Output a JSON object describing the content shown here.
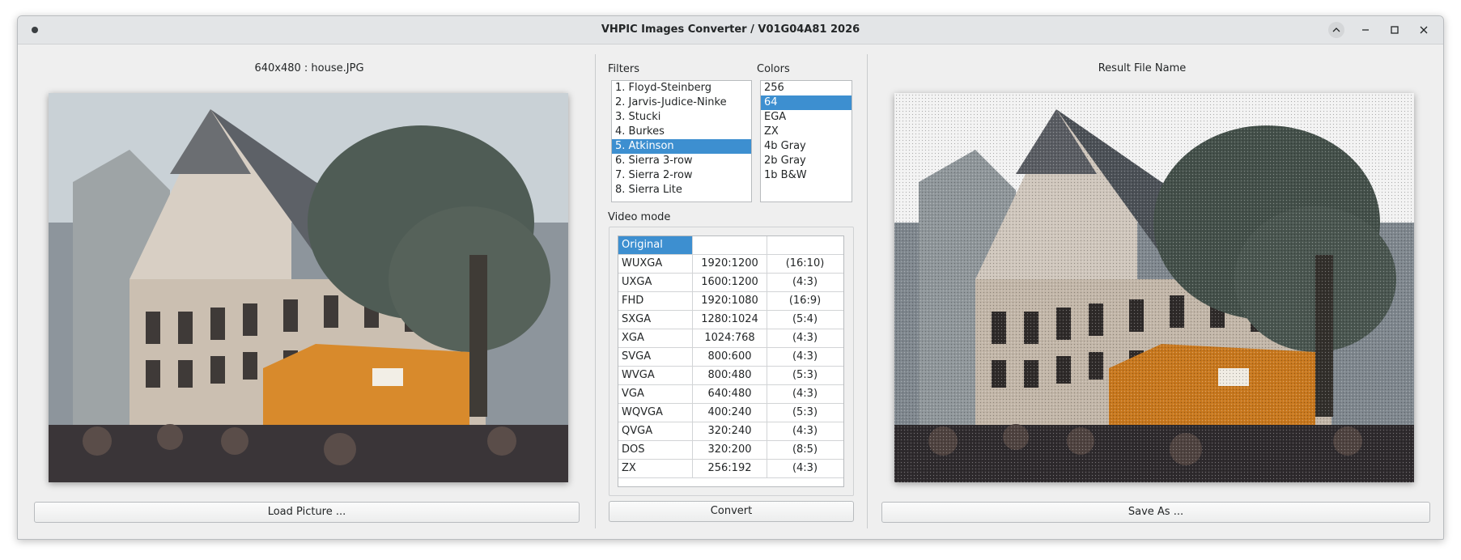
{
  "window": {
    "title": "VHPIC Images Converter / V01G04A81 2026"
  },
  "left_panel": {
    "label": "640x480 : house.JPG",
    "button": "Load Picture ..."
  },
  "filters": {
    "label": "Filters",
    "items": [
      "1. Floyd-Steinberg",
      "2. Jarvis-Judice-Ninke",
      "3. Stucki",
      "4. Burkes",
      "5. Atkinson",
      "6. Sierra 3-row",
      "7. Sierra 2-row",
      "8. Sierra Lite"
    ],
    "selected": 4
  },
  "colors": {
    "label": "Colors",
    "items": [
      "256",
      "64",
      "EGA",
      "ZX",
      "4b Gray",
      "2b Gray",
      "1b B&W"
    ],
    "selected": 1
  },
  "video_mode": {
    "label": "Video mode",
    "header": [
      "Original",
      "",
      ""
    ],
    "rows": [
      [
        "WUXGA",
        "1920:1200",
        "(16:10)"
      ],
      [
        "UXGA",
        "1600:1200",
        "(4:3)"
      ],
      [
        "FHD",
        "1920:1080",
        "(16:9)"
      ],
      [
        "SXGA",
        "1280:1024",
        "(5:4)"
      ],
      [
        "XGA",
        "1024:768",
        "(4:3)"
      ],
      [
        "SVGA",
        "800:600",
        "(4:3)"
      ],
      [
        "WVGA",
        "800:480",
        "(5:3)"
      ],
      [
        "VGA",
        "640:480",
        "(4:3)"
      ],
      [
        "WQVGA",
        "400:240",
        "(5:3)"
      ],
      [
        "QVGA",
        "320:240",
        "(4:3)"
      ],
      [
        "DOS",
        "320:200",
        "(8:5)"
      ],
      [
        "ZX",
        "256:192",
        "(4:3)"
      ]
    ]
  },
  "center": {
    "button": "Convert"
  },
  "right_panel": {
    "label": "Result File Name",
    "button": "Save As ..."
  },
  "colors_theme": {
    "selection": "#3d8fd0",
    "window_bg": "#efefef"
  }
}
